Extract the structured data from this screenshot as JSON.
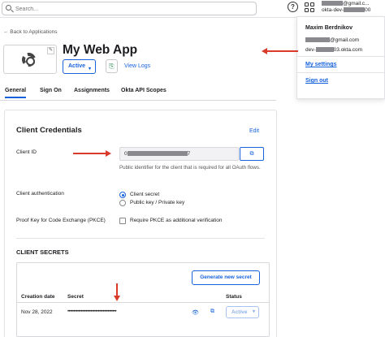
{
  "search": {
    "placeholder": "Search..."
  },
  "account": {
    "email_short": "@gmail.c...",
    "org_short_prefix": "okta-dev-",
    "org_short_suffix": "00"
  },
  "nav": {
    "back_label": "← Back to Applications"
  },
  "app": {
    "title": "My Web App",
    "status_label": "Active",
    "view_logs_label": "View Logs"
  },
  "tabs": [
    "General",
    "Sign On",
    "Assignments",
    "Okta API Scopes"
  ],
  "credentials": {
    "title": "Client Credentials",
    "edit_label": "Edit",
    "client_id_label": "Client ID",
    "client_id_value_prefix": "0",
    "client_id_value_suffix": "7",
    "client_id_hint": "Public identifier for the client that is required for all OAuth flows.",
    "client_auth_label": "Client authentication",
    "client_auth_options": [
      "Client secret",
      "Public key / Private key"
    ],
    "pkce_label": "Proof Key for Code Exchange (PKCE)",
    "pkce_option": "Require PKCE as additional verification"
  },
  "secrets": {
    "title": "CLIENT SECRETS",
    "generate_label": "Generate new secret",
    "headers": {
      "creation_date": "Creation date",
      "secret": "Secret",
      "status": "Status"
    },
    "rows": [
      {
        "creation_date": "Nov 28, 2022",
        "secret": "••••••••••••••••••••••••••••••••••••••••",
        "status": "Active"
      }
    ]
  },
  "user_menu": {
    "name": "Maxim Berdnikov",
    "email_suffix": "@gmail.com",
    "org_prefix": "dev-",
    "org_suffix": "03.okta.com",
    "my_settings_label": "My settings",
    "sign_out_label": "Sign out"
  },
  "colors": {
    "accent": "#1662dd",
    "annotation_arrow": "#d93a2a"
  }
}
